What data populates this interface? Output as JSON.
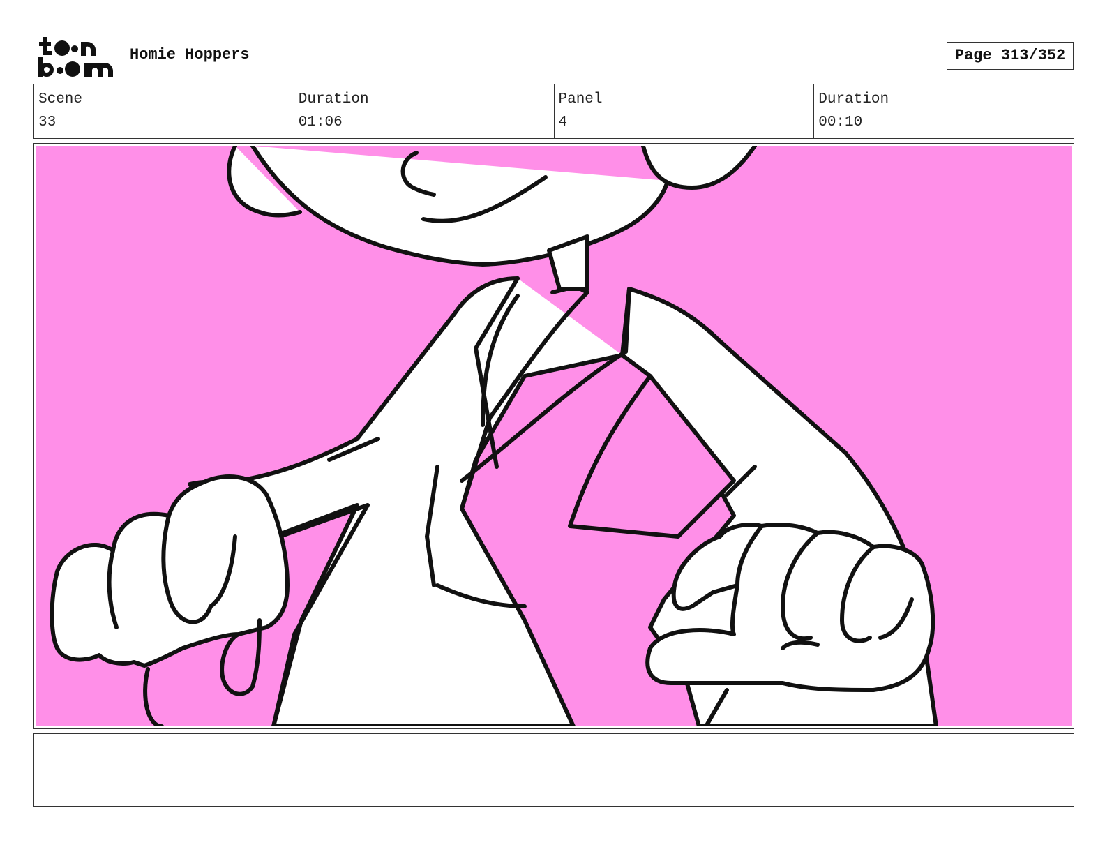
{
  "header": {
    "logo": {
      "line1": "toon",
      "line2": "boom"
    },
    "project_title": "Homie Hoppers",
    "page_label": "Page 313/352"
  },
  "info": {
    "scene_label": "Scene",
    "scene_value": "33",
    "scene_duration_label": "Duration",
    "scene_duration_value": "01:06",
    "panel_label": "Panel",
    "panel_value": "4",
    "panel_duration_label": "Duration",
    "panel_duration_value": "00:10"
  },
  "panel": {
    "background_color": "#ff8fe8",
    "line_color": "#111111",
    "fill_color": "#ffffff"
  },
  "notes": {
    "text": ""
  }
}
